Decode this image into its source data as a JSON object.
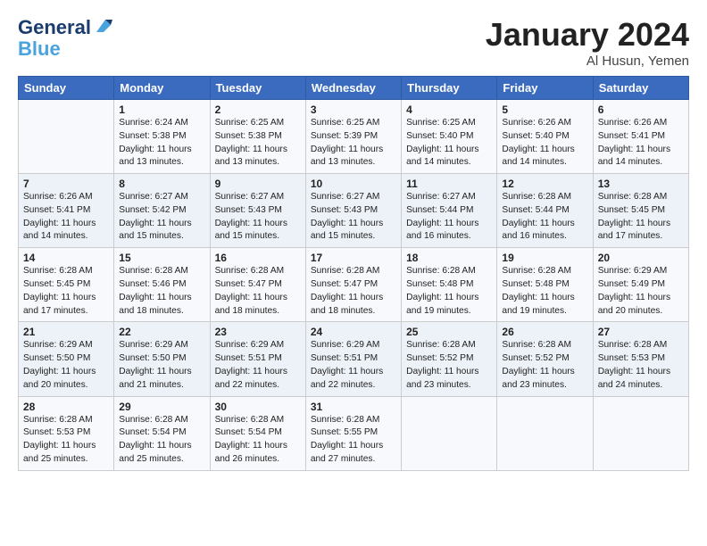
{
  "logo": {
    "line1": "General",
    "line2": "Blue"
  },
  "title": "January 2024",
  "subtitle": "Al Husun, Yemen",
  "days_of_week": [
    "Sunday",
    "Monday",
    "Tuesday",
    "Wednesday",
    "Thursday",
    "Friday",
    "Saturday"
  ],
  "weeks": [
    [
      {
        "day": "",
        "info": ""
      },
      {
        "day": "1",
        "info": "Sunrise: 6:24 AM\nSunset: 5:38 PM\nDaylight: 11 hours\nand 13 minutes."
      },
      {
        "day": "2",
        "info": "Sunrise: 6:25 AM\nSunset: 5:38 PM\nDaylight: 11 hours\nand 13 minutes."
      },
      {
        "day": "3",
        "info": "Sunrise: 6:25 AM\nSunset: 5:39 PM\nDaylight: 11 hours\nand 13 minutes."
      },
      {
        "day": "4",
        "info": "Sunrise: 6:25 AM\nSunset: 5:40 PM\nDaylight: 11 hours\nand 14 minutes."
      },
      {
        "day": "5",
        "info": "Sunrise: 6:26 AM\nSunset: 5:40 PM\nDaylight: 11 hours\nand 14 minutes."
      },
      {
        "day": "6",
        "info": "Sunrise: 6:26 AM\nSunset: 5:41 PM\nDaylight: 11 hours\nand 14 minutes."
      }
    ],
    [
      {
        "day": "7",
        "info": "Sunrise: 6:26 AM\nSunset: 5:41 PM\nDaylight: 11 hours\nand 14 minutes."
      },
      {
        "day": "8",
        "info": "Sunrise: 6:27 AM\nSunset: 5:42 PM\nDaylight: 11 hours\nand 15 minutes."
      },
      {
        "day": "9",
        "info": "Sunrise: 6:27 AM\nSunset: 5:43 PM\nDaylight: 11 hours\nand 15 minutes."
      },
      {
        "day": "10",
        "info": "Sunrise: 6:27 AM\nSunset: 5:43 PM\nDaylight: 11 hours\nand 15 minutes."
      },
      {
        "day": "11",
        "info": "Sunrise: 6:27 AM\nSunset: 5:44 PM\nDaylight: 11 hours\nand 16 minutes."
      },
      {
        "day": "12",
        "info": "Sunrise: 6:28 AM\nSunset: 5:44 PM\nDaylight: 11 hours\nand 16 minutes."
      },
      {
        "day": "13",
        "info": "Sunrise: 6:28 AM\nSunset: 5:45 PM\nDaylight: 11 hours\nand 17 minutes."
      }
    ],
    [
      {
        "day": "14",
        "info": "Sunrise: 6:28 AM\nSunset: 5:45 PM\nDaylight: 11 hours\nand 17 minutes."
      },
      {
        "day": "15",
        "info": "Sunrise: 6:28 AM\nSunset: 5:46 PM\nDaylight: 11 hours\nand 18 minutes."
      },
      {
        "day": "16",
        "info": "Sunrise: 6:28 AM\nSunset: 5:47 PM\nDaylight: 11 hours\nand 18 minutes."
      },
      {
        "day": "17",
        "info": "Sunrise: 6:28 AM\nSunset: 5:47 PM\nDaylight: 11 hours\nand 18 minutes."
      },
      {
        "day": "18",
        "info": "Sunrise: 6:28 AM\nSunset: 5:48 PM\nDaylight: 11 hours\nand 19 minutes."
      },
      {
        "day": "19",
        "info": "Sunrise: 6:28 AM\nSunset: 5:48 PM\nDaylight: 11 hours\nand 19 minutes."
      },
      {
        "day": "20",
        "info": "Sunrise: 6:29 AM\nSunset: 5:49 PM\nDaylight: 11 hours\nand 20 minutes."
      }
    ],
    [
      {
        "day": "21",
        "info": "Sunrise: 6:29 AM\nSunset: 5:50 PM\nDaylight: 11 hours\nand 20 minutes."
      },
      {
        "day": "22",
        "info": "Sunrise: 6:29 AM\nSunset: 5:50 PM\nDaylight: 11 hours\nand 21 minutes."
      },
      {
        "day": "23",
        "info": "Sunrise: 6:29 AM\nSunset: 5:51 PM\nDaylight: 11 hours\nand 22 minutes."
      },
      {
        "day": "24",
        "info": "Sunrise: 6:29 AM\nSunset: 5:51 PM\nDaylight: 11 hours\nand 22 minutes."
      },
      {
        "day": "25",
        "info": "Sunrise: 6:28 AM\nSunset: 5:52 PM\nDaylight: 11 hours\nand 23 minutes."
      },
      {
        "day": "26",
        "info": "Sunrise: 6:28 AM\nSunset: 5:52 PM\nDaylight: 11 hours\nand 23 minutes."
      },
      {
        "day": "27",
        "info": "Sunrise: 6:28 AM\nSunset: 5:53 PM\nDaylight: 11 hours\nand 24 minutes."
      }
    ],
    [
      {
        "day": "28",
        "info": "Sunrise: 6:28 AM\nSunset: 5:53 PM\nDaylight: 11 hours\nand 25 minutes."
      },
      {
        "day": "29",
        "info": "Sunrise: 6:28 AM\nSunset: 5:54 PM\nDaylight: 11 hours\nand 25 minutes."
      },
      {
        "day": "30",
        "info": "Sunrise: 6:28 AM\nSunset: 5:54 PM\nDaylight: 11 hours\nand 26 minutes."
      },
      {
        "day": "31",
        "info": "Sunrise: 6:28 AM\nSunset: 5:55 PM\nDaylight: 11 hours\nand 27 minutes."
      },
      {
        "day": "",
        "info": ""
      },
      {
        "day": "",
        "info": ""
      },
      {
        "day": "",
        "info": ""
      }
    ]
  ]
}
